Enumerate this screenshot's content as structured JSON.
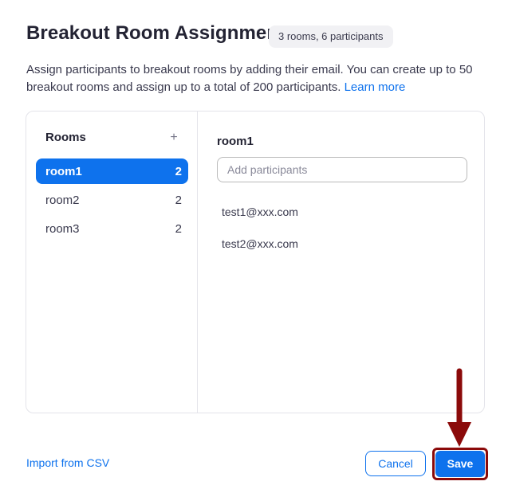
{
  "dialog": {
    "title": "Breakout Room Assignment",
    "count_badge": "3 rooms, 6 participants",
    "description": "Assign participants to breakout rooms by adding their email. You can create up to 50 breakout rooms and assign up to a total of 200 participants.",
    "learn_more": "Learn more"
  },
  "rooms": {
    "heading": "Rooms",
    "add_icon": "plus-icon",
    "add_symbol": "+",
    "items": [
      {
        "name": "room1",
        "count": "2",
        "active": true
      },
      {
        "name": "room2",
        "count": "2",
        "active": false
      },
      {
        "name": "room3",
        "count": "2",
        "active": false
      }
    ]
  },
  "detail": {
    "room_title": "room1",
    "add_placeholder": "Add participants",
    "participants": [
      "test1@xxx.com",
      "test2@xxx.com"
    ]
  },
  "footer": {
    "import_label": "Import from CSV",
    "cancel_label": "Cancel",
    "save_label": "Save"
  },
  "annotation": {
    "arrow_icon": "down-arrow-icon",
    "color": "#8b0a0a"
  },
  "colors": {
    "accent": "#0e72ed",
    "annotation": "#8b0a0a"
  }
}
